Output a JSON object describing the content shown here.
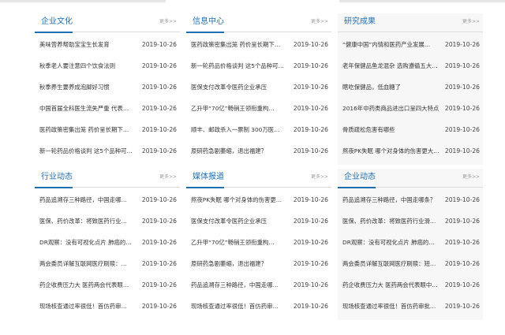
{
  "panels": [
    {
      "title": "企业文化",
      "more": "更多>>",
      "gray": false,
      "items": [
        {
          "text": "美味营养帮助宝宝生长发育",
          "date": "2019-10-26"
        },
        {
          "text": "秋季老人要注意四个饮食法则",
          "date": "2019-10-26"
        },
        {
          "text": "秋季养生要养成泡脚好习惯",
          "date": "2019-10-26"
        },
        {
          "text": "中国首届全科医生流失严重 代表…",
          "date": "2019-10-26"
        },
        {
          "text": "医药政策密集出笼 药价呈长期下…",
          "date": "2019-10-26"
        },
        {
          "text": "新一轮药品价格谈判 这5个品种可…",
          "date": "2019-10-26"
        }
      ]
    },
    {
      "title": "信息中心",
      "more": "更多>>",
      "gray": false,
      "items": [
        {
          "text": "医药政策密集出笼 药价呈长期下…",
          "date": "2019-10-26"
        },
        {
          "text": "新一轮药品价格谈判 这5个品种可…",
          "date": "2019-10-26"
        },
        {
          "text": "医保支付改革令医药企业承压",
          "date": "2019-10-26"
        },
        {
          "text": "乙升甲“70亿”畅销王领衔重构…",
          "date": "2019-10-26"
        },
        {
          "text": "顺丰、邮政杀入一票制 300万医…",
          "date": "2019-10-26"
        },
        {
          "text": "原研药急剧萎缩，退出福建？",
          "date": "2019-10-26"
        }
      ]
    },
    {
      "title": "研究成果",
      "more": "更多>>",
      "gray": true,
      "items": [
        {
          "text": "“健康中国”内情和医药产业发展…",
          "date": "2019-10-26"
        },
        {
          "text": "老年保健品鱼龙混杂 选购遵循五大…",
          "date": "2019-10-26"
        },
        {
          "text": "瞎吃保健品，低血糖了",
          "date": "2019-10-26"
        },
        {
          "text": "2016年中药类商品进出口呈四大特点",
          "date": "2019-10-26"
        },
        {
          "text": "骨质疏松危害有哪些",
          "date": "2019-10-26"
        },
        {
          "text": "熬夜PK失眠 哪个对身体的伤害更大…",
          "date": "2019-10-26"
        }
      ]
    },
    {
      "title": "行业动态",
      "more": "更多>>",
      "gray": false,
      "items": [
        {
          "text": "药品追溯存三种路径，中国走哪…",
          "date": "2019-10-26"
        },
        {
          "text": "医保、药价改革：将致医药行业…",
          "date": "2019-10-26"
        },
        {
          "text": "DR观察：没有可视化点片 肺癌的…",
          "date": "2019-10-26"
        },
        {
          "text": "两会委员详解互联网医疗刷赎：…",
          "date": "2019-10-26"
        },
        {
          "text": "药企收费压力大 医药两会代表眼…",
          "date": "2019-10-26"
        },
        {
          "text": "现场核查通过率很低！首仿药审…",
          "date": "2019-10-26"
        }
      ]
    },
    {
      "title": "媒体报道",
      "more": "更多>>",
      "gray": false,
      "items": [
        {
          "text": "熬夜PK失眠 哪个对身体的伤害更…",
          "date": "2019-10-26"
        },
        {
          "text": "医保支付改革令医药企业承压",
          "date": "2019-10-26"
        },
        {
          "text": "乙升甲“70亿”畅销王领衔重构…",
          "date": "2019-10-26"
        },
        {
          "text": "原研药急剧萎缩，退出福建？",
          "date": "2019-10-26"
        },
        {
          "text": "药品追溯存三种路径，中国走哪…",
          "date": "2019-10-26"
        },
        {
          "text": "现场核查通过率很低！首仿药审…",
          "date": "2019-10-26"
        }
      ]
    },
    {
      "title": "企业动态",
      "more": "更多>>",
      "gray": true,
      "items": [
        {
          "text": "药品追溯存三种路径，中国走哪条？",
          "date": "2019-10-26"
        },
        {
          "text": "医保、药价改革：将致医药行业滑…",
          "date": "2019-10-26"
        },
        {
          "text": "DR观察：没有可视化点片 肺癌的…",
          "date": "2019-10-26"
        },
        {
          "text": "两会委员详解互联网医疗刷赎：短…",
          "date": "2019-10-26"
        },
        {
          "text": "药企收费压力大 医药两会代表眼中…",
          "date": "2019-10-26"
        },
        {
          "text": "现场核查通过率很低！首仿药审批…",
          "date": "2019-10-26"
        }
      ]
    }
  ]
}
